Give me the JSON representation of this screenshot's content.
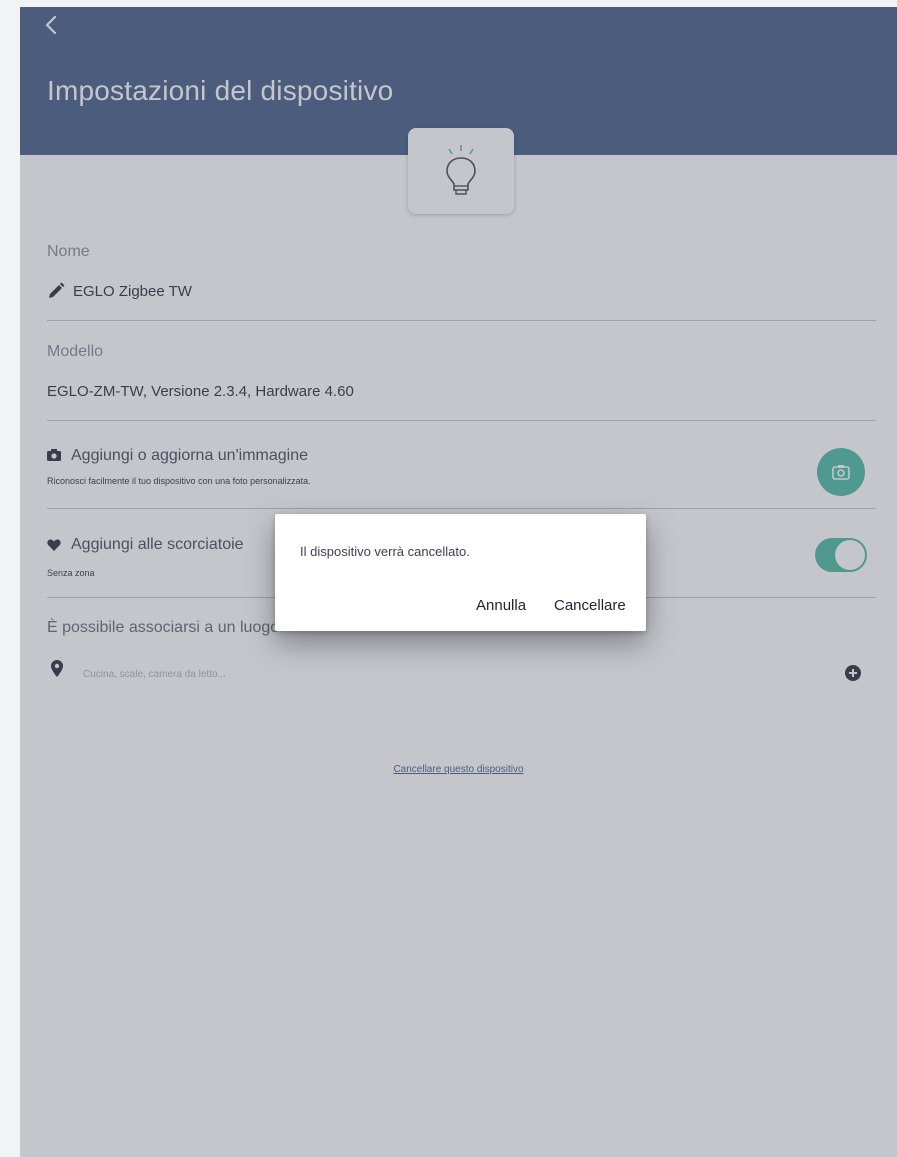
{
  "header": {
    "back_icon": "chevron-left-icon",
    "title": "Impostazioni del dispositivo",
    "bg_color": "#3d5480"
  },
  "device_icon": "lightbulb-icon",
  "name_section": {
    "label": "Nome",
    "icon": "pencil-icon",
    "value": "EGLO Zigbee TW"
  },
  "model_section": {
    "label": "Modello",
    "value": "EGLO-ZM-TW, Versione 2.3.4, Hardware 4.60"
  },
  "image_section": {
    "icon": "camera-icon",
    "title": "Aggiungi o aggiorna un'immagine",
    "subtitle": "Riconosci facilmente il tuo dispositivo con una foto personalizzata.",
    "button_icon": "camera-icon",
    "accent": "#45b79b"
  },
  "shortcut_section": {
    "icon": "heart-icon",
    "title": "Aggiungi alle scorciatoie",
    "subtitle": "Senza zona",
    "toggle_on": true
  },
  "location_section": {
    "label": "È possibile associarsi a un luogo",
    "icon": "map-pin-icon",
    "placeholder": "Cucina, scale, camera da letto...",
    "add_icon": "plus-circle-icon"
  },
  "delete_link": "Cancellare questo dispositivo",
  "dialog": {
    "message": "Il dispositivo verrà cancellato.",
    "cancel_label": "Annulla",
    "confirm_label": "Cancellare"
  }
}
